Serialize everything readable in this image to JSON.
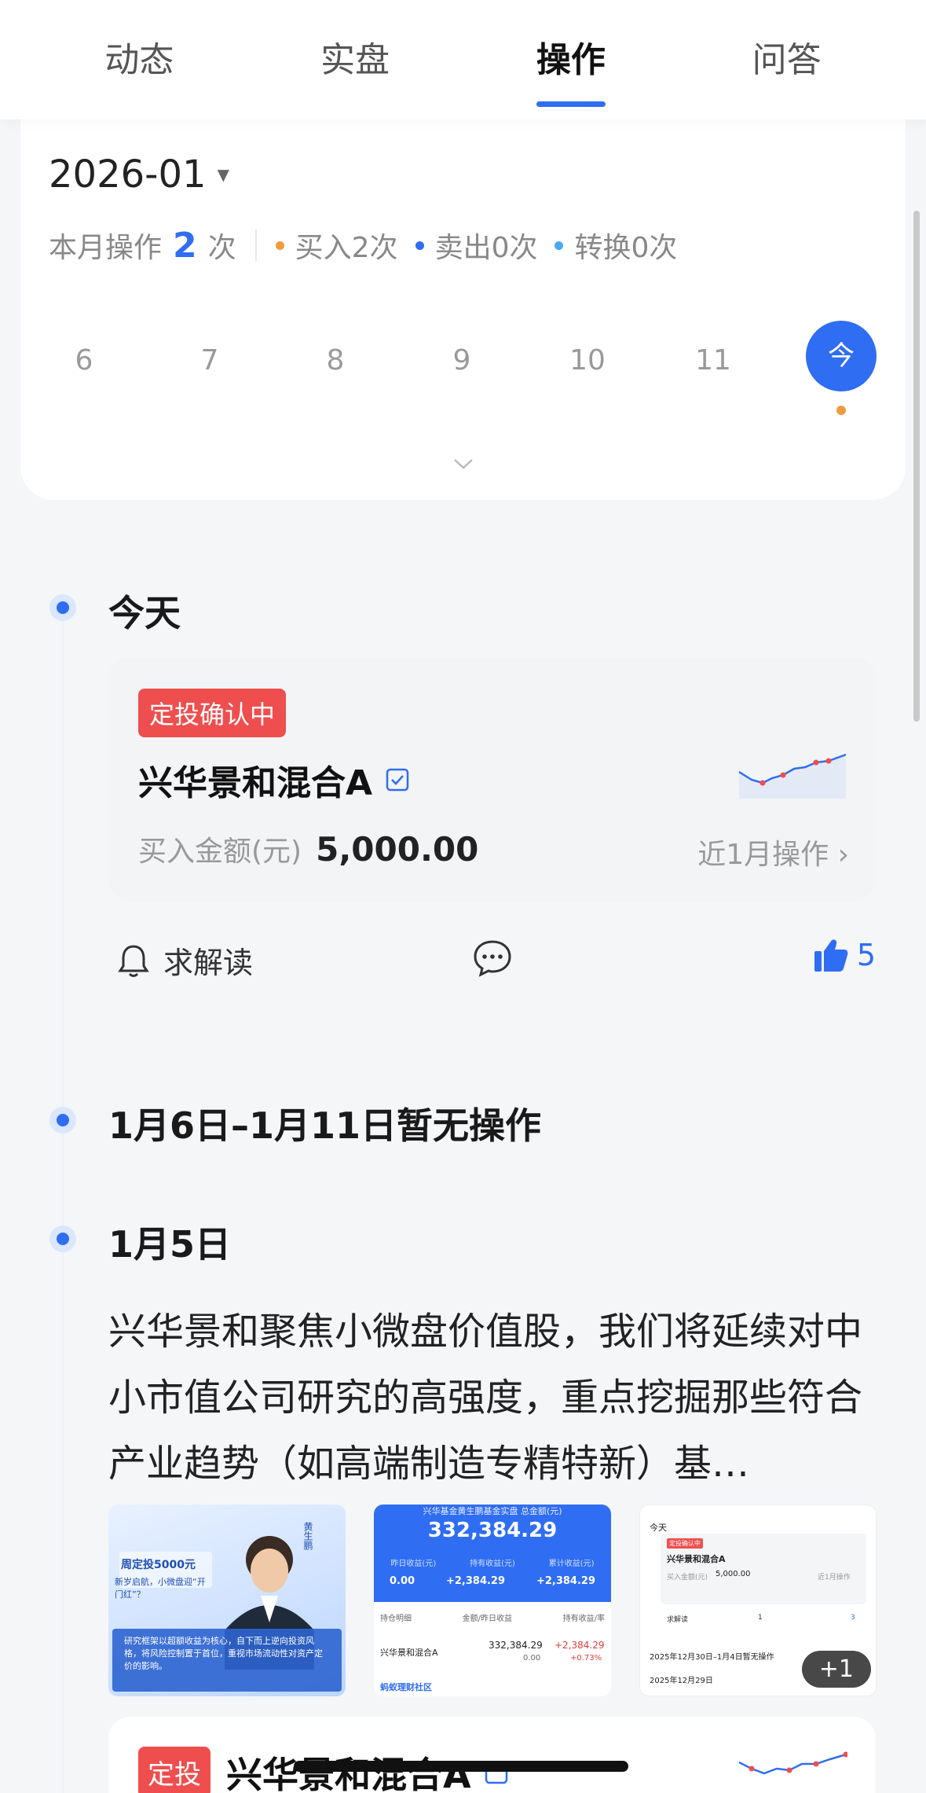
{
  "tabs": [
    {
      "label": "动态",
      "active": false
    },
    {
      "label": "实盘",
      "active": false
    },
    {
      "label": "操作",
      "active": true
    },
    {
      "label": "问答",
      "active": false
    }
  ],
  "calendar": {
    "month": "2026-01",
    "summary_prefix": "本月操作",
    "count": "2",
    "summary_suffix": "次",
    "legend": [
      {
        "label": "买入2次",
        "color": "#f09a3e"
      },
      {
        "label": "卖出0次",
        "color": "#2f6df3"
      },
      {
        "label": "转换0次",
        "color": "#4aa8f0"
      }
    ],
    "days": [
      "6",
      "7",
      "8",
      "9",
      "10",
      "11",
      "今"
    ]
  },
  "timeline": {
    "today": {
      "title": "今天",
      "badge": "定投确认中",
      "fund": "兴华景和混合A",
      "amount_label": "买入金额(元)",
      "amount_value": "5,000.00",
      "recent_link": "近1月操作",
      "actions": {
        "ask": "求解读",
        "likes": "5"
      }
    },
    "gap": {
      "title": "1月6日–1月11日暂无操作"
    },
    "jan5": {
      "title": "1月5日",
      "post": "兴华景和聚焦小微盘价值股，我们将延续对中小市值公司研究的高强度，重点挖掘那些符合产业趋势（如高端制造专精特新）基…",
      "more_images": "+1",
      "thumb1": {
        "name": "黄生鹏",
        "headline": "周定投5000元",
        "sub": "新岁启航，小微盘迎“开门红”？",
        "quote": "研究框架以超额收益为核心，自下而上逆向投资风格，将风险控制置于首位，重视市场流动性对资产定价的影响。"
      },
      "thumb2": {
        "header": "兴华基金黄生鹏基金实盘 总金额(元)",
        "total": "332,384.29",
        "cols": [
          "昨日收益(元)",
          "持有收益(元)",
          "累计收益(元)"
        ],
        "vals": [
          "0.00",
          "+2,384.29",
          "+2,384.29"
        ],
        "row_head": [
          "持仓明细",
          "金额/昨日收益",
          "持有收益/率"
        ],
        "fund": "兴华景和混合A",
        "amt": "332,384.29",
        "y": "0.00",
        "profit": "+2,384.29",
        "rate": "+0.73%",
        "footer": "蚂蚁理财社区"
      },
      "thumb3": {
        "today": "今天",
        "badge": "定投确认中",
        "fund": "兴华景和混合A",
        "amt_label": "买入金额(元)",
        "amt": "5,000.00",
        "recent": "近1月操作",
        "ask": "求解读",
        "c": "1",
        "l": "3",
        "line1": "2025年12月30日–1月4日暂无操作",
        "line2": "2025年12月29日"
      }
    },
    "peek": {
      "badge": "定投",
      "fund": "兴华景和混合A"
    }
  }
}
